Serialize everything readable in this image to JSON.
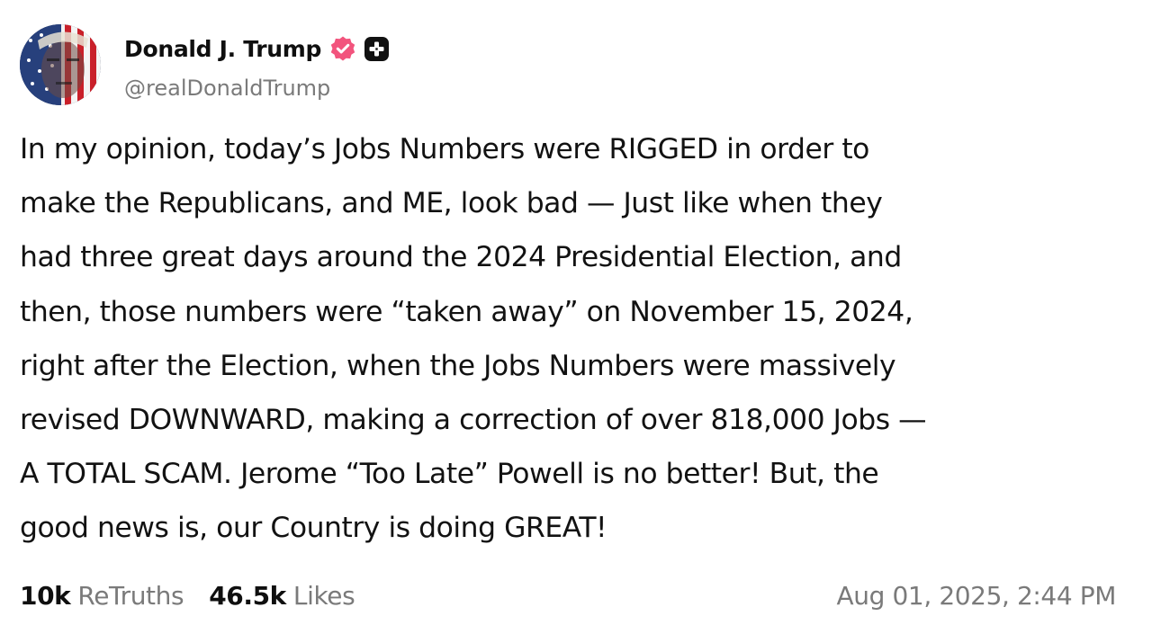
{
  "post": {
    "author": {
      "display_name": "Donald J. Trump",
      "handle": "@realDonaldTrump",
      "verified_badge_icon": "verified-badge-icon",
      "verified_badge_color": "#f2547d",
      "plus_badge_icon": "plus-badge-icon"
    },
    "body_lines": [
      "In my opinion, today’s Jobs Numbers were RIGGED in order to",
      "make the Republicans, and ME, look bad — Just like when they",
      "had three great days around the 2024 Presidential Election, and",
      "then, those numbers were “taken away” on November 15, 2024,",
      "right after the Election, when the Jobs Numbers were massively",
      "revised DOWNWARD, making a correction of over 818,000 Jobs —",
      "A TOTAL SCAM. Jerome “Too Late” Powell is no better! But, the",
      "good news is, our Country is doing GREAT!"
    ],
    "stats": {
      "retruths_count": "10k",
      "retruths_label": "ReTruths",
      "likes_count": "46.5k",
      "likes_label": "Likes"
    },
    "timestamp": "Aug 01, 2025, 2:44 PM"
  }
}
